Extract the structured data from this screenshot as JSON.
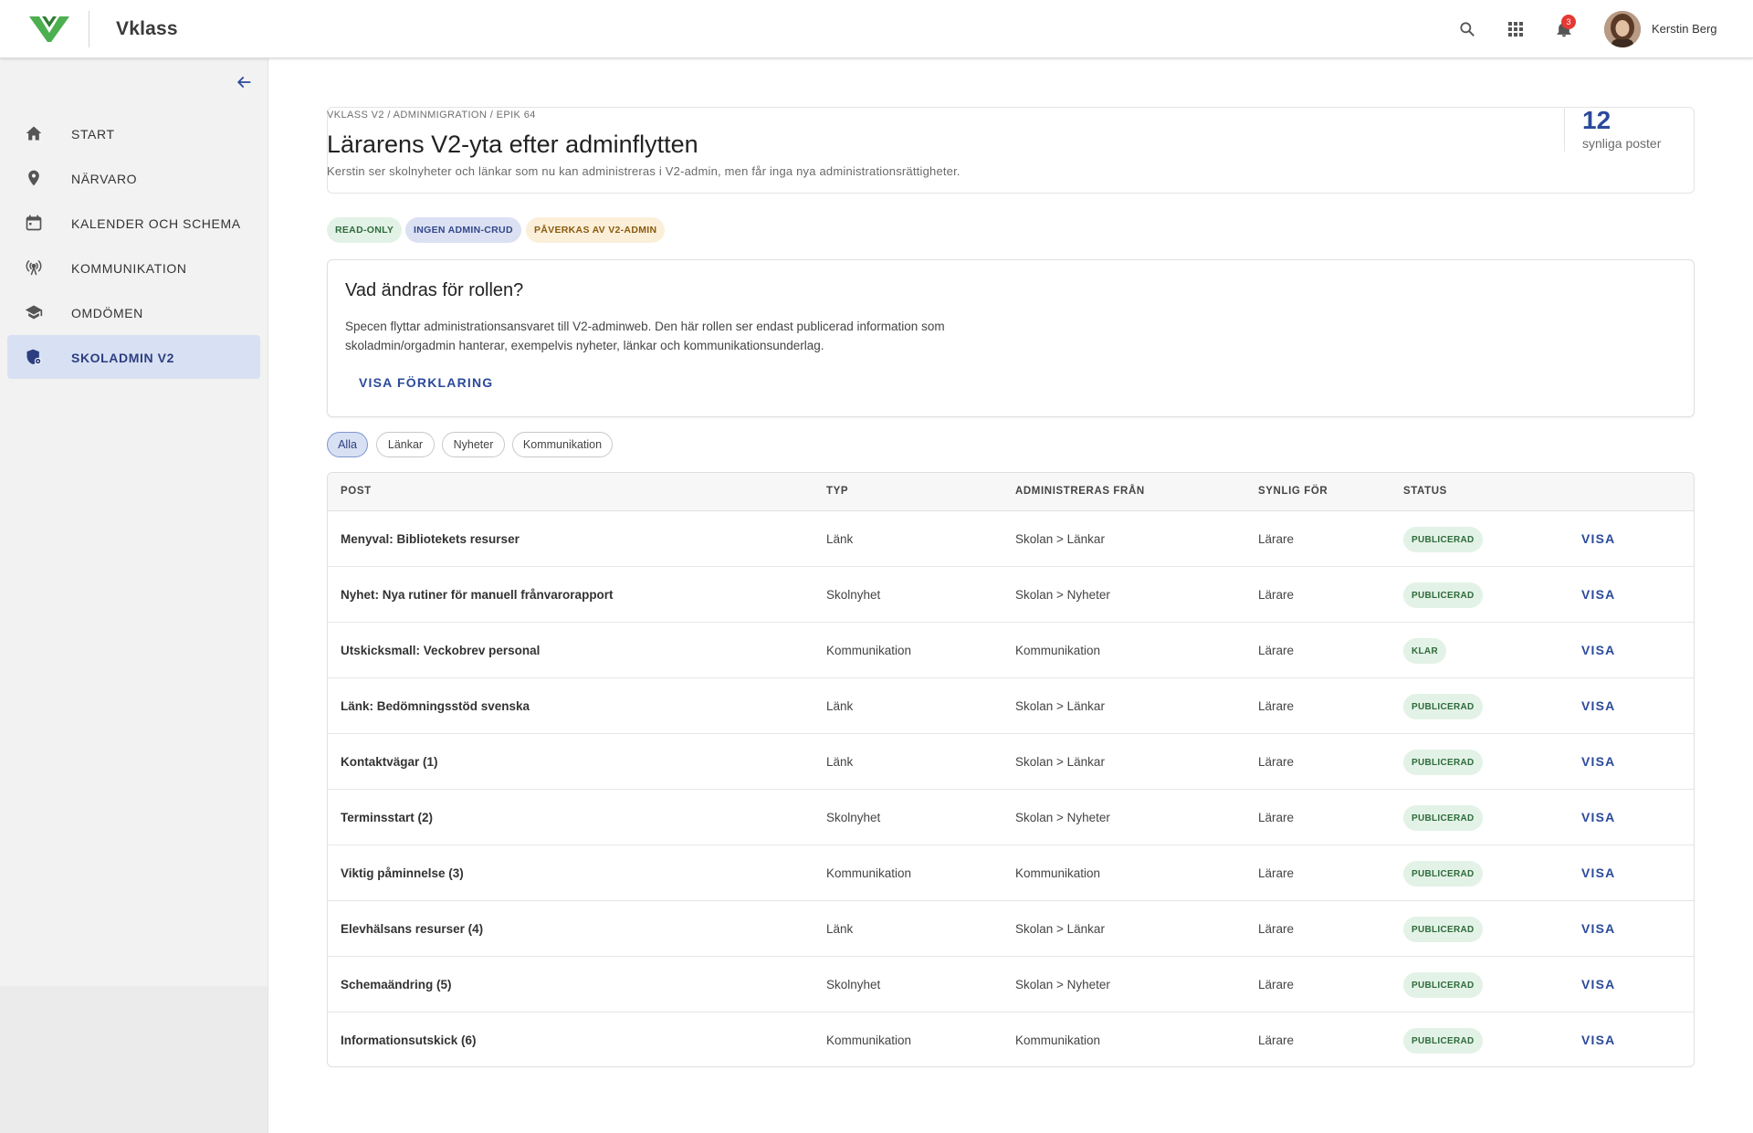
{
  "app": {
    "brand": "Vklass",
    "user_name": "Kerstin Berg",
    "notification_count": "3",
    "icons": {
      "search": "search-icon",
      "apps": "apps-grid-icon",
      "notifications": "bell-icon",
      "collapse": "arrow-left-icon"
    }
  },
  "colors": {
    "accent": "#2b4a9b",
    "logo_green": "#4caf50",
    "active_nav": "#d8e0f3",
    "badge_red": "#e53935"
  },
  "sidebar": {
    "items": [
      {
        "label": "START",
        "icon": "home-icon",
        "active": false
      },
      {
        "label": "NÄRVARO",
        "icon": "location-pin-icon",
        "active": false
      },
      {
        "label": "KALENDER OCH SCHEMA",
        "icon": "calendar-icon",
        "active": false
      },
      {
        "label": "KOMMUNIKATION",
        "icon": "broadcast-icon",
        "active": false
      },
      {
        "label": "OMDÖMEN",
        "icon": "graduation-cap-icon",
        "active": false
      },
      {
        "label": "SKOLADMIN V2",
        "icon": "admin-shield-icon",
        "active": true
      }
    ]
  },
  "header": {
    "breadcrumb": "VKLASS V2 / ADMINMIGRATION / EPIK 64",
    "title": "Lärarens V2-yta efter adminflytten",
    "subtitle": "Kerstin ser skolnyheter och länkar som nu kan administreras i V2-admin, men får inga nya administrationsrättigheter.",
    "count_value": "12",
    "count_label": "synliga poster"
  },
  "chips": {
    "readonly": "READ-ONLY",
    "no_crud": "INGEN ADMIN-CRUD",
    "affected": "PÅVERKAS AV V2-ADMIN"
  },
  "info": {
    "title": "Vad ändras för rollen?",
    "text": "Specen flyttar administrationsansvaret till V2-adminweb. Den här rollen ser endast publicerad information som skoladmin/orgadmin hanterar, exempelvis nyheter, länkar och kommunikationsunderlag.",
    "link": "VISA FÖRKLARING"
  },
  "filters": [
    {
      "label": "Alla",
      "active": true
    },
    {
      "label": "Länkar",
      "active": false
    },
    {
      "label": "Nyheter",
      "active": false
    },
    {
      "label": "Kommunikation",
      "active": false
    }
  ],
  "table": {
    "headers": {
      "post": "POST",
      "typ": "TYP",
      "admin": "ADMINISTRERAS FRÅN",
      "synlig": "SYNLIG FÖR",
      "status": "STATUS"
    },
    "action_label": "VISA",
    "rows": [
      {
        "post": "Menyval: Bibliotekets resurser",
        "typ": "Länk",
        "admin": "Skolan > Länkar",
        "synlig": "Lärare",
        "status": "PUBLICERAD"
      },
      {
        "post": "Nyhet: Nya rutiner för manuell frånvarorapport",
        "typ": "Skolnyhet",
        "admin": "Skolan > Nyheter",
        "synlig": "Lärare",
        "status": "PUBLICERAD"
      },
      {
        "post": "Utskicksmall: Veckobrev personal",
        "typ": "Kommunikation",
        "admin": "Kommunikation",
        "synlig": "Lärare",
        "status": "KLAR"
      },
      {
        "post": "Länk: Bedömningsstöd svenska",
        "typ": "Länk",
        "admin": "Skolan > Länkar",
        "synlig": "Lärare",
        "status": "PUBLICERAD"
      },
      {
        "post": "Kontaktvägar (1)",
        "typ": "Länk",
        "admin": "Skolan > Länkar",
        "synlig": "Lärare",
        "status": "PUBLICERAD"
      },
      {
        "post": "Terminsstart (2)",
        "typ": "Skolnyhet",
        "admin": "Skolan > Nyheter",
        "synlig": "Lärare",
        "status": "PUBLICERAD"
      },
      {
        "post": "Viktig påminnelse (3)",
        "typ": "Kommunikation",
        "admin": "Kommunikation",
        "synlig": "Lärare",
        "status": "PUBLICERAD"
      },
      {
        "post": "Elevhälsans resurser (4)",
        "typ": "Länk",
        "admin": "Skolan > Länkar",
        "synlig": "Lärare",
        "status": "PUBLICERAD"
      },
      {
        "post": "Schemaändring (5)",
        "typ": "Skolnyhet",
        "admin": "Skolan > Nyheter",
        "synlig": "Lärare",
        "status": "PUBLICERAD"
      },
      {
        "post": "Informationsutskick (6)",
        "typ": "Kommunikation",
        "admin": "Kommunikation",
        "synlig": "Lärare",
        "status": "PUBLICERAD"
      }
    ]
  }
}
